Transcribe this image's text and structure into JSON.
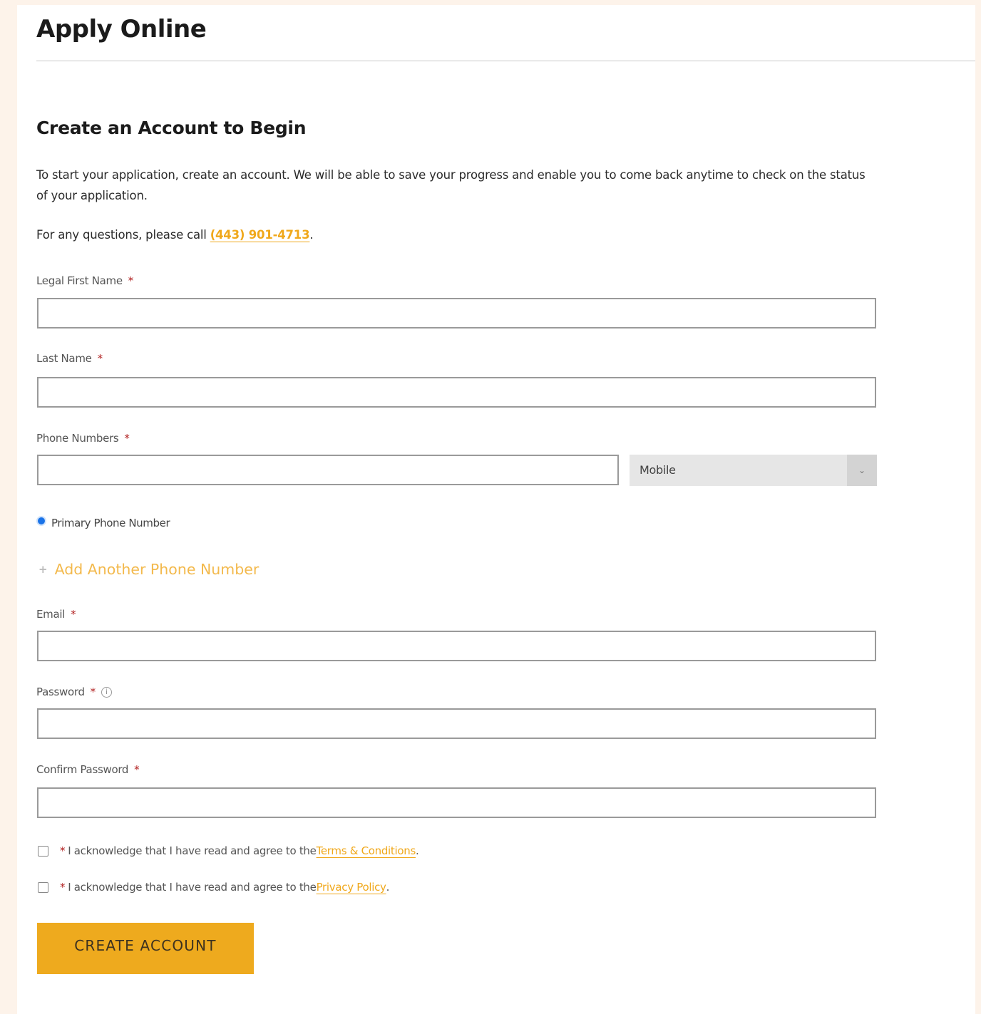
{
  "page": {
    "title": "Apply Online"
  },
  "section": {
    "heading": "Create an Account to Begin",
    "intro": "To start your application, create an account. We will be able to save your progress and enable you to come back anytime to check on the status of your application.",
    "questions_prefix": "For any questions, please call ",
    "phone": "(443) 901-4713",
    "questions_suffix": "."
  },
  "form": {
    "required_marker": "*",
    "first_name": {
      "label": "Legal First Name",
      "value": ""
    },
    "last_name": {
      "label": "Last Name",
      "value": ""
    },
    "phone": {
      "label": "Phone Numbers",
      "value": "",
      "type_selected": "Mobile"
    },
    "primary_phone_label": "Primary Phone Number",
    "add_phone_label": "Add Another Phone Number",
    "email": {
      "label": "Email",
      "value": ""
    },
    "password": {
      "label": "Password",
      "value": "",
      "info_glyph": "i"
    },
    "confirm_password": {
      "label": "Confirm Password",
      "value": ""
    },
    "terms": {
      "prefix": "I acknowledge that I have read and agree to the ",
      "link": "Terms & Conditions",
      "suffix": "."
    },
    "privacy": {
      "prefix": "I acknowledge that I have read and agree to the ",
      "link": "Privacy Policy",
      "suffix": "."
    },
    "submit_label": "CREATE ACCOUNT"
  },
  "icons": {
    "plus": "+",
    "chevron": "⌄"
  },
  "colors": {
    "background": "#fdf3ea",
    "accent": "#f0a81b",
    "button": "#eeaa1e",
    "required": "#b01e1e",
    "radio": "#1a73e8"
  }
}
